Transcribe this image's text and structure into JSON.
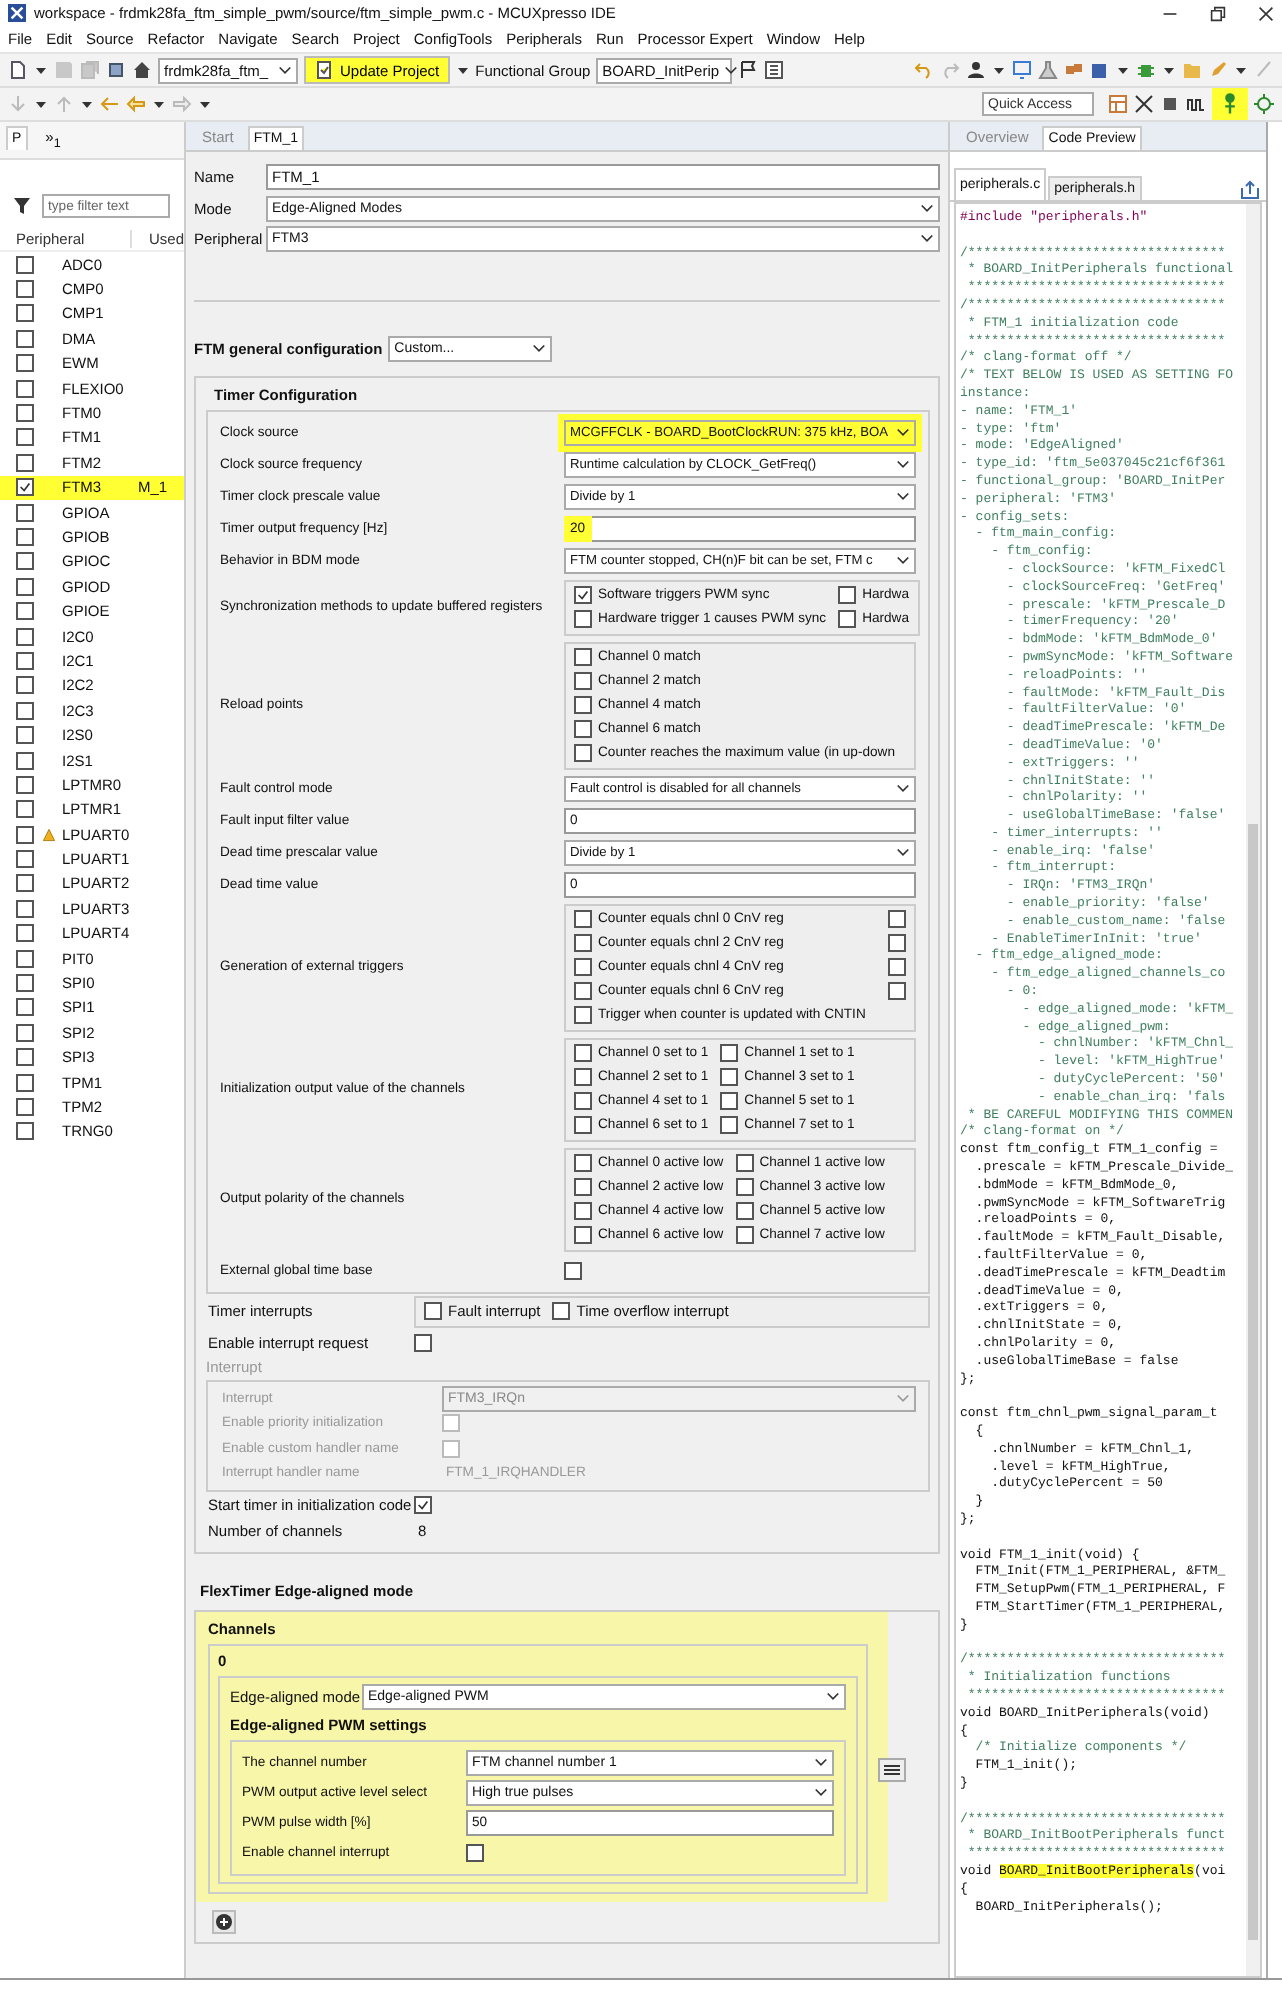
{
  "window": {
    "title": "workspace - frdmk28fa_ftm_simple_pwm/source/ftm_simple_pwm.c - MCUXpresso IDE"
  },
  "menu": [
    "File",
    "Edit",
    "Source",
    "Refactor",
    "Navigate",
    "Search",
    "Project",
    "ConfigTools",
    "Peripherals",
    "Run",
    "Processor Expert",
    "Window",
    "Help"
  ],
  "toolbar": {
    "project": "frdmk28fa_ftm_",
    "update_button": {
      "label": "Update Project",
      "highlighted": true
    },
    "group_label": "Functional Group",
    "group": "BOARD_InitPerip",
    "quick_access": {
      "placeholder": "Quick Access"
    },
    "pin_button": {
      "highlighted": true
    }
  },
  "peripherals_view": {
    "tabs": [
      {
        "label": "P",
        "selected": true
      },
      {
        "label": "»$_{1}$",
        "selected": false
      }
    ],
    "filter": {
      "placeholder": "type filter text"
    },
    "columns": [
      "Peripheral",
      "Used"
    ],
    "rows": [
      {
        "name": "ADC0",
        "checked": false,
        "warning": false,
        "highlighted": false
      },
      {
        "name": "CMP0",
        "checked": false,
        "warning": false,
        "highlighted": false
      },
      {
        "name": "CMP1",
        "checked": false,
        "warning": false,
        "highlighted": false
      },
      {
        "name": "DMA",
        "checked": false,
        "warning": false,
        "highlighted": false
      },
      {
        "name": "EWM",
        "checked": false,
        "warning": false,
        "highlighted": false
      },
      {
        "name": "FLEXIO0",
        "checked": false,
        "warning": false,
        "highlighted": false
      },
      {
        "name": "FTM0",
        "checked": false,
        "warning": false,
        "highlighted": false
      },
      {
        "name": "FTM1",
        "checked": false,
        "warning": false,
        "highlighted": false
      },
      {
        "name": "FTM2",
        "checked": false,
        "warning": false,
        "highlighted": false
      },
      {
        "name": "FTM3",
        "checked": true,
        "used": "M_1",
        "warning": false,
        "highlighted": true
      },
      {
        "name": "GPIOA",
        "checked": false,
        "warning": false,
        "highlighted": false
      },
      {
        "name": "GPIOB",
        "checked": false,
        "warning": false,
        "highlighted": false
      },
      {
        "name": "GPIOC",
        "checked": false,
        "warning": false,
        "highlighted": false
      },
      {
        "name": "GPIOD",
        "checked": false,
        "warning": false,
        "highlighted": false
      },
      {
        "name": "GPIOE",
        "checked": false,
        "warning": false,
        "highlighted": false
      },
      {
        "name": "I2C0",
        "checked": false,
        "warning": false,
        "highlighted": false
      },
      {
        "name": "I2C1",
        "checked": false,
        "warning": false,
        "highlighted": false
      },
      {
        "name": "I2C2",
        "checked": false,
        "warning": false,
        "highlighted": false
      },
      {
        "name": "I2C3",
        "checked": false,
        "warning": false,
        "highlighted": false
      },
      {
        "name": "I2S0",
        "checked": false,
        "warning": false,
        "highlighted": false
      },
      {
        "name": "I2S1",
        "checked": false,
        "warning": false,
        "highlighted": false
      },
      {
        "name": "LPTMR0",
        "checked": false,
        "warning": false,
        "highlighted": false
      },
      {
        "name": "LPTMR1",
        "checked": false,
        "warning": false,
        "highlighted": false
      },
      {
        "name": "LPUART0",
        "checked": false,
        "warning": true,
        "highlighted": false
      },
      {
        "name": "LPUART1",
        "checked": false,
        "warning": false,
        "highlighted": false
      },
      {
        "name": "LPUART2",
        "checked": false,
        "warning": false,
        "highlighted": false
      },
      {
        "name": "LPUART3",
        "checked": false,
        "warning": false,
        "highlighted": false
      },
      {
        "name": "LPUART4",
        "checked": false,
        "warning": false,
        "highlighted": false
      },
      {
        "name": "PIT0",
        "checked": false,
        "warning": false,
        "highlighted": false
      },
      {
        "name": "SPI0",
        "checked": false,
        "warning": false,
        "highlighted": false
      },
      {
        "name": "SPI1",
        "checked": false,
        "warning": false,
        "highlighted": false
      },
      {
        "name": "SPI2",
        "checked": false,
        "warning": false,
        "highlighted": false
      },
      {
        "name": "SPI3",
        "checked": false,
        "warning": false,
        "highlighted": false
      },
      {
        "name": "TPM1",
        "checked": false,
        "warning": false,
        "highlighted": false
      },
      {
        "name": "TPM2",
        "checked": false,
        "warning": false,
        "highlighted": false
      },
      {
        "name": "TRNG0",
        "checked": false,
        "warning": false,
        "highlighted": false
      }
    ]
  },
  "editor": {
    "tabs": [
      {
        "label": "Start",
        "selected": false
      },
      {
        "label": "FTM_1",
        "selected": true
      }
    ],
    "fields": [
      {
        "label": "Name",
        "kind": "text",
        "value": "FTM_1"
      },
      {
        "label": "Mode",
        "kind": "select",
        "value": "Edge-Aligned Modes"
      },
      {
        "label": "Peripheral",
        "kind": "select",
        "value": "FTM3"
      }
    ],
    "general_config": {
      "label": "FTM general configuration",
      "value": "Custom..."
    },
    "timer_configuration": {
      "title": "Timer Configuration",
      "rows": [
        {
          "label": "Clock source",
          "kind": "select",
          "value": "MCGFFCLK - BOARD_BootClockRUN: 375 kHz, BOA",
          "highlighted": true
        },
        {
          "label": "Clock source frequency",
          "kind": "select",
          "value": "Runtime calculation by CLOCK_GetFreq()",
          "highlighted": false
        },
        {
          "label": "Timer clock prescale value",
          "kind": "select",
          "value": "Divide by 1",
          "highlighted": false
        },
        {
          "label": "Timer output frequency [Hz]",
          "kind": "text",
          "value": "20",
          "highlighted": true
        },
        {
          "label": "Behavior in BDM mode",
          "kind": "select",
          "value": "FTM counter stopped, CH(n)F bit can be set, FTM c",
          "highlighted": false
        },
        {
          "label": "Synchronization methods to update buffered registers",
          "kind": "checklist",
          "highlighted": false,
          "lines": [
            [
              {
                "label": "Software triggers PWM sync",
                "checked": true
              },
              {
                "label": "Hardwa",
                "checked": false
              }
            ],
            [
              {
                "label": "Hardware trigger 1 causes PWM sync",
                "checked": false
              },
              {
                "label": "Hardwa",
                "checked": false
              }
            ]
          ]
        },
        {
          "label": "Reload points",
          "kind": "checklist",
          "highlighted": false,
          "lines": [
            [
              {
                "label": "Channel 0 match",
                "checked": false
              }
            ],
            [
              {
                "label": "Channel 2 match",
                "checked": false
              }
            ],
            [
              {
                "label": "Channel 4 match",
                "checked": false
              }
            ],
            [
              {
                "label": "Channel 6 match",
                "checked": false
              }
            ],
            [
              {
                "label": "Counter reaches the maximum value (in up-down",
                "checked": false
              }
            ]
          ]
        },
        {
          "label": "Fault control mode",
          "kind": "select",
          "value": "Fault control is disabled for all channels",
          "highlighted": false
        },
        {
          "label": "Fault input filter value",
          "kind": "text",
          "value": "0",
          "highlighted": false
        },
        {
          "label": "Dead time prescalar value",
          "kind": "select",
          "value": "Divide by 1",
          "highlighted": false
        },
        {
          "label": "Dead time value",
          "kind": "text",
          "value": "0",
          "highlighted": false
        },
        {
          "label": "Generation of external triggers",
          "kind": "checklist",
          "highlighted": false,
          "lines": [
            [
              {
                "label": "Counter equals chnl 0 CnV reg",
                "checked": false
              },
              {
                "checked": false
              }
            ],
            [
              {
                "label": "Counter equals chnl 2 CnV reg",
                "checked": false
              },
              {
                "checked": false
              }
            ],
            [
              {
                "label": "Counter equals chnl 4 CnV reg",
                "checked": false
              },
              {
                "checked": false
              }
            ],
            [
              {
                "label": "Counter equals chnl 6 CnV reg",
                "checked": false
              },
              {
                "checked": false
              }
            ],
            [
              {
                "label": "Trigger when counter is updated with CNTIN",
                "checked": false
              }
            ]
          ]
        },
        {
          "label": "Initialization output value of the channels",
          "kind": "checklist",
          "highlighted": false,
          "lines": [
            [
              {
                "label": "Channel 0 set to 1",
                "checked": false
              },
              {
                "label": "Channel 1 set to 1",
                "checked": false
              }
            ],
            [
              {
                "label": "Channel 2 set to 1",
                "checked": false
              },
              {
                "label": "Channel 3 set to 1",
                "checked": false
              }
            ],
            [
              {
                "label": "Channel 4 set to 1",
                "checked": false
              },
              {
                "label": "Channel 5 set to 1",
                "checked": false
              }
            ],
            [
              {
                "label": "Channel 6 set to 1",
                "checked": false
              },
              {
                "label": "Channel 7 set to 1",
                "checked": false
              }
            ]
          ]
        },
        {
          "label": "Output polarity of the channels",
          "kind": "checklist",
          "highlighted": false,
          "lines": [
            [
              {
                "label": "Channel 0 active low",
                "checked": false
              },
              {
                "label": "Channel 1 active low",
                "checked": false
              }
            ],
            [
              {
                "label": "Channel 2 active low",
                "checked": false
              },
              {
                "label": "Channel 3 active low",
                "checked": false
              }
            ],
            [
              {
                "label": "Channel 4 active low",
                "checked": false
              },
              {
                "label": "Channel 5 active low",
                "checked": false
              }
            ],
            [
              {
                "label": "Channel 6 active low",
                "checked": false
              },
              {
                "label": "Channel 7 active low",
                "checked": false
              }
            ]
          ]
        },
        {
          "label": "External global time base",
          "kind": "checkbox",
          "checked": false,
          "highlighted": false
        }
      ]
    },
    "options": [
      {
        "label": "Timer interrupts",
        "kind": "checklist",
        "lines": [
          [
            {
              "label": "Fault interrupt",
              "checked": false
            },
            {
              "label": "Time overflow interrupt",
              "checked": false
            }
          ]
        ]
      },
      {
        "label": "Enable interrupt request",
        "kind": "checkbox",
        "checked": false
      },
      {
        "label": "Interrupt",
        "kind": "group",
        "disabled": true,
        "rows": [
          {
            "label": "Interrupt",
            "kind": "select",
            "value": "FTM3_IRQn"
          },
          {
            "label": "Enable priority initialization",
            "kind": "checkbox",
            "checked": false
          },
          {
            "label": "Enable custom handler name",
            "kind": "checkbox",
            "checked": false
          },
          {
            "label": "Interrupt handler name",
            "kind": "value",
            "value": "FTM_1_IRQHANDLER"
          }
        ]
      },
      {
        "label": "Start timer in initialization code",
        "kind": "checkbox",
        "checked": true
      },
      {
        "label": "Number of channels",
        "kind": "value",
        "value": "8"
      }
    ],
    "edge_mode": {
      "title": "FlexTimer Edge-aligned mode",
      "channels": {
        "title": "Channels",
        "highlighted": true,
        "items": [
          {
            "index": "0",
            "mode_label": "Edge-aligned mode",
            "mode": "Edge-aligned PWM",
            "settings_title": "Edge-aligned PWM settings",
            "rows": [
              {
                "label": "The channel number",
                "kind": "select",
                "value": "FTM channel number 1"
              },
              {
                "label": "PWM output active level select",
                "kind": "select",
                "value": "High true pulses"
              },
              {
                "label": "PWM pulse width [%]",
                "kind": "text",
                "value": "50"
              },
              {
                "label": "Enable channel interrupt",
                "kind": "checkbox",
                "checked": false
              }
            ]
          }
        ]
      }
    }
  },
  "code_view": {
    "tabs": [
      {
        "label": "Overview",
        "selected": false
      },
      {
        "label": "Code Preview",
        "selected": true
      }
    ],
    "files": [
      {
        "label": "peripherals.c",
        "selected": true
      },
      {
        "label": "peripherals.h",
        "selected": false
      }
    ],
    "lines": [
      {
        "kind": "directive",
        "text": "#include \"peripherals.h\""
      },
      {
        "kind": "blank"
      },
      {
        "kind": "comment",
        "text": "/*********************************"
      },
      {
        "kind": "comment",
        "text": " * BOARD_InitPeripherals functional"
      },
      {
        "kind": "comment",
        "text": " *********************************"
      },
      {
        "kind": "comment",
        "text": "/*********************************"
      },
      {
        "kind": "comment",
        "text": " * FTM_1 initialization code"
      },
      {
        "kind": "comment",
        "text": " *********************************"
      },
      {
        "kind": "comment",
        "text": "/* clang-format off */"
      },
      {
        "kind": "comment",
        "text": "/* TEXT BELOW IS USED AS SETTING FO"
      },
      {
        "kind": "comment",
        "text": "instance:"
      },
      {
        "kind": "comment",
        "text": "- name: 'FTM_1'"
      },
      {
        "kind": "comment",
        "text": "- type: 'ftm'"
      },
      {
        "kind": "comment",
        "text": "- mode: 'EdgeAligned'"
      },
      {
        "kind": "comment",
        "text": "- type_id: 'ftm_5e037045c21cf6f361"
      },
      {
        "kind": "comment",
        "text": "- functional_group: 'BOARD_InitPer"
      },
      {
        "kind": "comment",
        "text": "- peripheral: 'FTM3'"
      },
      {
        "kind": "comment",
        "text": "- config_sets:"
      },
      {
        "kind": "comment",
        "text": "  - ftm_main_config:"
      },
      {
        "kind": "comment",
        "text": "    - ftm_config:"
      },
      {
        "kind": "comment",
        "text": "      - clockSource: 'kFTM_FixedCl"
      },
      {
        "kind": "comment",
        "text": "      - clockSourceFreq: 'GetFreq'"
      },
      {
        "kind": "comment",
        "text": "      - prescale: 'kFTM_Prescale_D"
      },
      {
        "kind": "comment",
        "text": "      - timerFrequency: '20'"
      },
      {
        "kind": "comment",
        "text": "      - bdmMode: 'kFTM_BdmMode_0'"
      },
      {
        "kind": "comment",
        "text": "      - pwmSyncMode: 'kFTM_Software"
      },
      {
        "kind": "comment",
        "text": "      - reloadPoints: ''"
      },
      {
        "kind": "comment",
        "text": "      - faultMode: 'kFTM_Fault_Dis"
      },
      {
        "kind": "comment",
        "text": "      - faultFilterValue: '0'"
      },
      {
        "kind": "comment",
        "text": "      - deadTimePrescale: 'kFTM_De"
      },
      {
        "kind": "comment",
        "text": "      - deadTimeValue: '0'"
      },
      {
        "kind": "comment",
        "text": "      - extTriggers: ''"
      },
      {
        "kind": "comment",
        "text": "      - chnlInitState: ''"
      },
      {
        "kind": "comment",
        "text": "      - chnlPolarity: ''"
      },
      {
        "kind": "comment",
        "text": "      - useGlobalTimeBase: 'false'"
      },
      {
        "kind": "comment",
        "text": "    - timer_interrupts: ''"
      },
      {
        "kind": "comment",
        "text": "    - enable_irq: 'false'"
      },
      {
        "kind": "comment",
        "text": "    - ftm_interrupt:"
      },
      {
        "kind": "comment",
        "text": "      - IRQn: 'FTM3_IRQn'"
      },
      {
        "kind": "comment",
        "text": "      - enable_priority: 'false'"
      },
      {
        "kind": "comment",
        "text": "      - enable_custom_name: 'false"
      },
      {
        "kind": "comment",
        "text": "    - EnableTimerInInit: 'true'"
      },
      {
        "kind": "comment",
        "text": "  - ftm_edge_aligned_mode:"
      },
      {
        "kind": "comment",
        "text": "    - ftm_edge_aligned_channels_co"
      },
      {
        "kind": "comment",
        "text": "      - 0:"
      },
      {
        "kind": "comment",
        "text": "        - edge_aligned_mode: 'kFTM_"
      },
      {
        "kind": "comment",
        "text": "        - edge_aligned_pwm:"
      },
      {
        "kind": "comment",
        "text": "          - chnlNumber: 'kFTM_Chnl_"
      },
      {
        "kind": "comment",
        "text": "          - level: 'kFTM_HighTrue'"
      },
      {
        "kind": "comment",
        "text": "          - dutyCyclePercent: '50'"
      },
      {
        "kind": "comment",
        "text": "          - enable_chan_irq: 'fals"
      },
      {
        "kind": "comment",
        "text": " * BE CAREFUL MODIFYING THIS COMMEN"
      },
      {
        "kind": "comment",
        "text": "/* clang-format on */"
      },
      {
        "kind": "code",
        "text": "const ftm_config_t FTM_1_config = "
      },
      {
        "kind": "code",
        "text": "  .prescale = kFTM_Prescale_Divide_"
      },
      {
        "kind": "code",
        "text": "  .bdmMode = kFTM_BdmMode_0,"
      },
      {
        "kind": "code",
        "text": "  .pwmSyncMode = kFTM_SoftwareTrig"
      },
      {
        "kind": "code",
        "text": "  .reloadPoints = 0,"
      },
      {
        "kind": "code",
        "text": "  .faultMode = kFTM_Fault_Disable,"
      },
      {
        "kind": "code",
        "text": "  .faultFilterValue = 0,"
      },
      {
        "kind": "code",
        "text": "  .deadTimePrescale = kFTM_Deadtim"
      },
      {
        "kind": "code",
        "text": "  .deadTimeValue = 0,"
      },
      {
        "kind": "code",
        "text": "  .extTriggers = 0,"
      },
      {
        "kind": "code",
        "text": "  .chnlInitState = 0,"
      },
      {
        "kind": "code",
        "text": "  .chnlPolarity = 0,"
      },
      {
        "kind": "code",
        "text": "  .useGlobalTimeBase = false"
      },
      {
        "kind": "code",
        "text": "};"
      },
      {
        "kind": "blank"
      },
      {
        "kind": "code",
        "text": "const ftm_chnl_pwm_signal_param_t"
      },
      {
        "kind": "code",
        "text": "  {"
      },
      {
        "kind": "code",
        "text": "    .chnlNumber = kFTM_Chnl_1,"
      },
      {
        "kind": "code",
        "text": "    .level = kFTM_HighTrue,"
      },
      {
        "kind": "code",
        "text": "    .dutyCyclePercent = 50"
      },
      {
        "kind": "code",
        "text": "  }"
      },
      {
        "kind": "code",
        "text": "};"
      },
      {
        "kind": "blank"
      },
      {
        "kind": "code",
        "text": "void FTM_1_init(void) {"
      },
      {
        "kind": "code",
        "text": "  FTM_Init(FTM_1_PERIPHERAL, &FTM_"
      },
      {
        "kind": "code",
        "text": "  FTM_SetupPwm(FTM_1_PERIPHERAL, F"
      },
      {
        "kind": "code",
        "text": "  FTM_StartTimer(FTM_1_PERIPHERAL,"
      },
      {
        "kind": "code",
        "text": "}"
      },
      {
        "kind": "blank"
      },
      {
        "kind": "comment",
        "text": "/*********************************"
      },
      {
        "kind": "comment",
        "text": " * Initialization functions"
      },
      {
        "kind": "comment",
        "text": " *********************************"
      },
      {
        "kind": "code",
        "text": "void BOARD_InitPeripherals(void)"
      },
      {
        "kind": "code",
        "text": "{"
      },
      {
        "kind": "comment",
        "text": "  /* Initialize components */"
      },
      {
        "kind": "code",
        "text": "  FTM_1_init();"
      },
      {
        "kind": "code",
        "text": "}"
      },
      {
        "kind": "blank"
      },
      {
        "kind": "comment",
        "text": "/*********************************"
      },
      {
        "kind": "comment",
        "text": " * BOARD_InitBootPeripherals funct"
      },
      {
        "kind": "comment",
        "text": " *********************************"
      },
      {
        "kind": "code",
        "parts": [
          {
            "text": "void ",
            "highlighted": false
          },
          {
            "text": "BOARD_InitBootPeripherals",
            "highlighted": true
          },
          {
            "text": "(voi",
            "highlighted": false
          }
        ]
      },
      {
        "kind": "code",
        "text": "{"
      },
      {
        "kind": "code",
        "text": "  BOARD_InitPeripherals();"
      }
    ]
  }
}
